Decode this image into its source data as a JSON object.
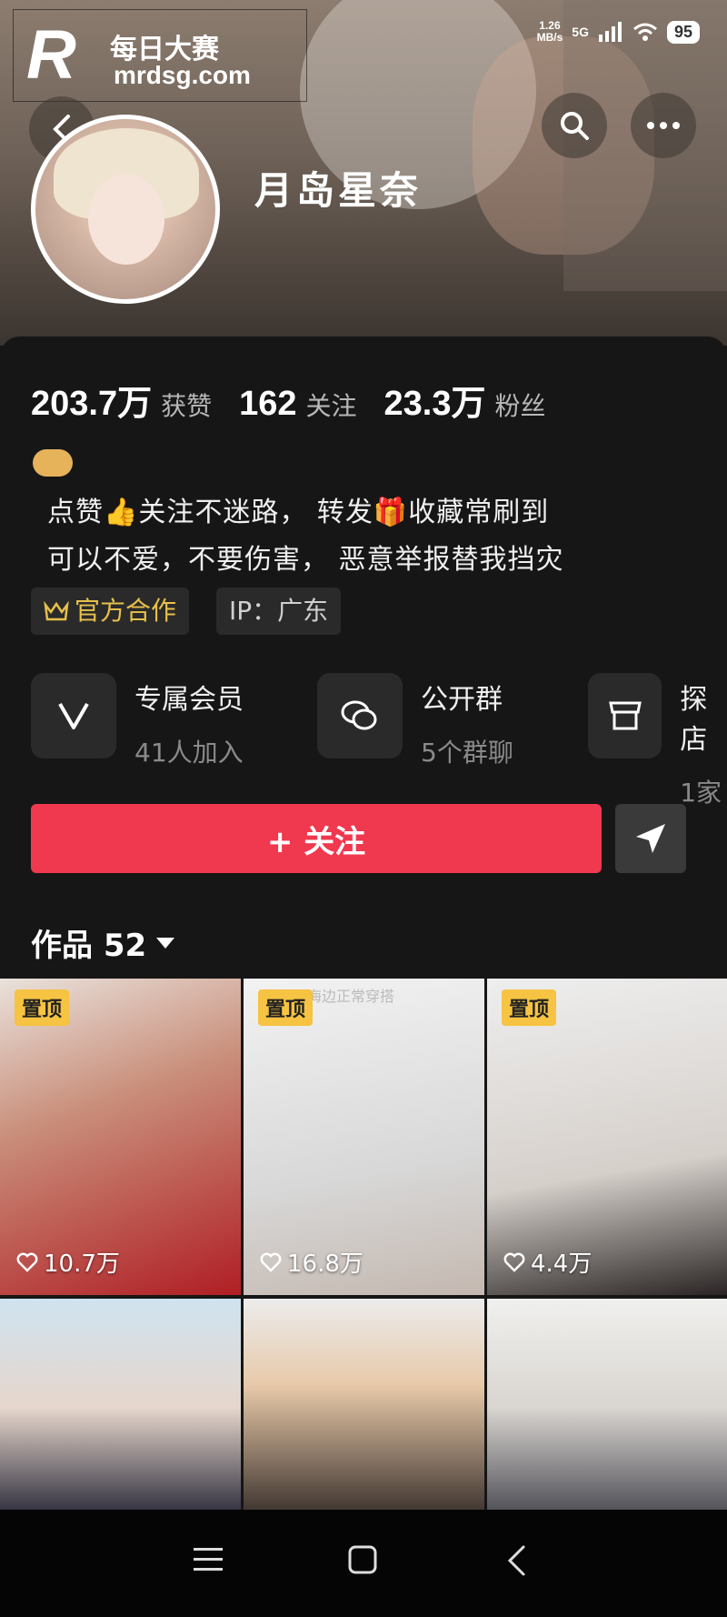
{
  "watermark": {
    "logo": "R",
    "title": "每日大赛",
    "site": "mrdsg.com"
  },
  "status": {
    "net_speed": "1.26",
    "net_unit": "MB/s",
    "network": "5G",
    "battery": "95"
  },
  "profile": {
    "name": "月岛星奈"
  },
  "stats": [
    {
      "value": "203.7万",
      "label": "获赞"
    },
    {
      "value": "162",
      "label": "关注"
    },
    {
      "value": "23.3万",
      "label": "粉丝"
    }
  ],
  "bio": {
    "line1": "点赞👍关注不迷路，  转发🎁收藏常刷到",
    "line2": "可以不爱，不要伤害，  恶意举报替我挡灾"
  },
  "tags": {
    "official": "官方合作",
    "ip": "IP：广东"
  },
  "cards": [
    {
      "title": "专属会员",
      "sub": "41人加入"
    },
    {
      "title": "公开群",
      "sub": "5个群聊"
    },
    {
      "title": "探店",
      "sub": "1家"
    }
  ],
  "follow_label": "+ 关注",
  "works": {
    "label": "作品 52"
  },
  "videos": [
    {
      "pinned": "置顶",
      "likes": "10.7万"
    },
    {
      "pinned": "置顶",
      "likes": "16.8万",
      "caption": "海边正常穿搭"
    },
    {
      "pinned": "置顶",
      "likes": "4.4万"
    },
    {},
    {},
    {}
  ],
  "colors": {
    "accent": "#f0384f",
    "pin": "#f6c342",
    "official": "#e7c04b"
  }
}
